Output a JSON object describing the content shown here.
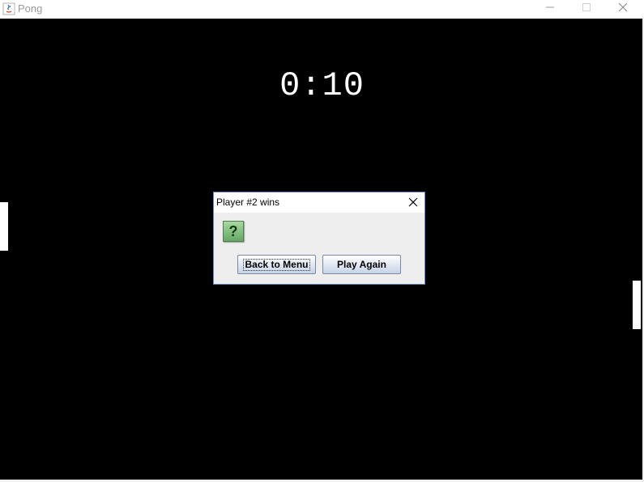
{
  "window": {
    "title": "Pong",
    "icons": [
      "java-icon",
      "minimize-icon",
      "maximize-icon",
      "close-icon"
    ]
  },
  "game": {
    "timer": "0:10",
    "background_color": "#000000",
    "paddle_color": "#ffffff"
  },
  "dialog": {
    "title": "Player #2 wins",
    "icon": "question-icon",
    "icon_glyph": "?",
    "buttons": {
      "back_to_menu": "Back to Menu",
      "play_again": "Play Again"
    },
    "border_color": "#6a85b9"
  }
}
